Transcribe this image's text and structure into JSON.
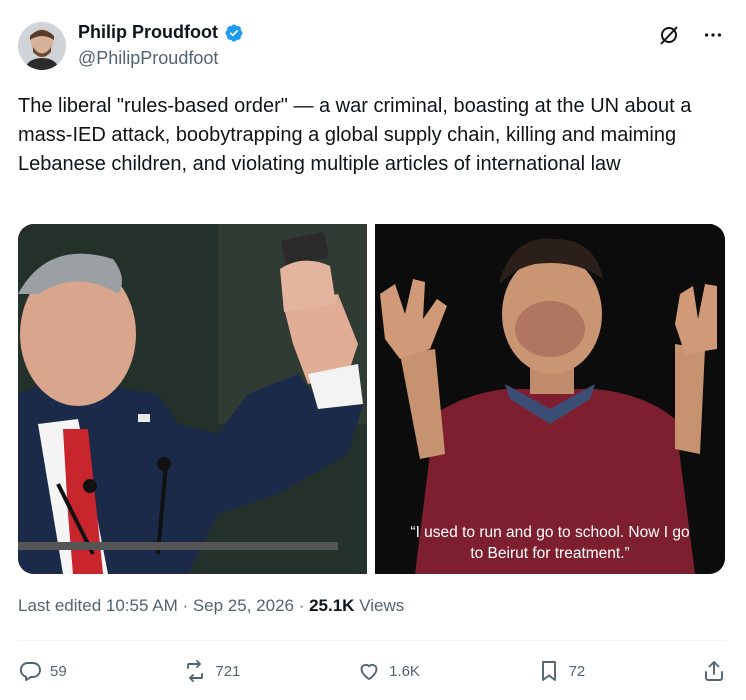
{
  "author": {
    "name": "Philip Proudfoot",
    "handle": "@PhilipProudfoot"
  },
  "tweet": {
    "text": "The liberal \"rules-based order\" — a war criminal, boasting at the UN about a mass-IED attack, boobytrapping a global supply chain, killing and maiming Lebanese children, and violating multiple articles of international law",
    "media_right_caption_line1": "“I used to run and go to school. Now I go",
    "media_right_caption_line2": "to Beirut for treatment.”"
  },
  "meta": {
    "edited_prefix": "Last edited 10:55 AM · Sep 25, 2026 · ",
    "views_count": "25.1K",
    "views_label": "Views"
  },
  "actions": {
    "replies": "59",
    "reposts": "721",
    "likes": "1.6K",
    "bookmarks": "72"
  },
  "colors": {
    "text_primary": "#0f1419",
    "text_secondary": "#536471",
    "verified": "#1d9bf0"
  },
  "icons": [
    "verified-badge-icon",
    "grok-icon",
    "more-icon",
    "reply-icon",
    "repost-icon",
    "like-icon",
    "bookmark-icon",
    "share-icon"
  ]
}
